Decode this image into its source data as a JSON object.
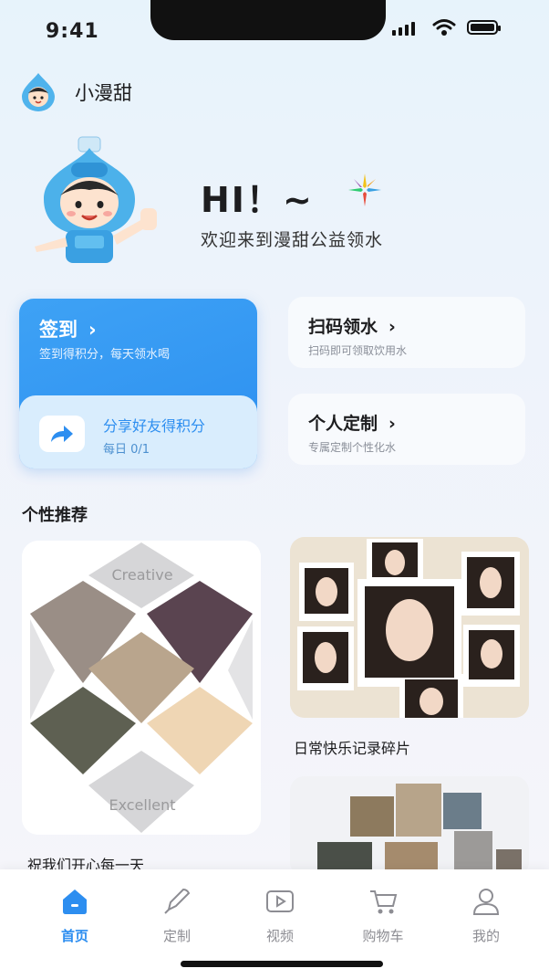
{
  "status": {
    "time": "9:41"
  },
  "header": {
    "brand": "小漫甜",
    "greeting": "HI！~",
    "welcome": "欢迎来到漫甜公益领水"
  },
  "cards": {
    "signin": {
      "title": "签到",
      "subtitle": "签到得积分，每天领水喝"
    },
    "share": {
      "title": "分享好友得积分",
      "subtitle": "每日 0/1"
    },
    "scan": {
      "title": "扫码领水",
      "subtitle": "扫码即可领取饮用水"
    },
    "custom": {
      "title": "个人定制",
      "subtitle": "专属定制个性化水"
    }
  },
  "recommend": {
    "section_title": "个性推荐",
    "items": [
      {
        "caption": "祝我们开心每一天",
        "collage_top": "Creative",
        "collage_bottom": "Excellent"
      },
      {
        "caption": "日常快乐记录碎片"
      }
    ]
  },
  "tabbar": {
    "items": [
      {
        "label": "首页",
        "icon": "home-icon",
        "active": true
      },
      {
        "label": "定制",
        "icon": "pen-icon"
      },
      {
        "label": "视频",
        "icon": "video-icon"
      },
      {
        "label": "购物车",
        "icon": "cart-icon"
      },
      {
        "label": "我的",
        "icon": "user-icon"
      }
    ]
  },
  "colors": {
    "accent": "#2d8ef0",
    "card_blue": "#3ea2f5",
    "tab_inactive": "#8d8d93"
  }
}
